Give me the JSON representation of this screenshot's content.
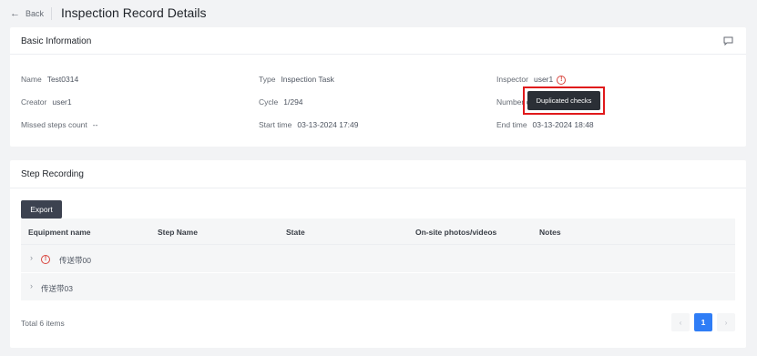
{
  "header": {
    "back_label": "Back",
    "title": "Inspection Record Details"
  },
  "basic_info": {
    "title": "Basic Information",
    "fields": {
      "name": {
        "label": "Name",
        "value": "Test0314"
      },
      "type": {
        "label": "Type",
        "value": "Inspection Task"
      },
      "inspector": {
        "label": "Inspector",
        "value": "user1"
      },
      "creator": {
        "label": "Creator",
        "value": "user1"
      },
      "cycle": {
        "label": "Cycle",
        "value": "1/294"
      },
      "number": {
        "label": "Number c"
      },
      "missed": {
        "label": "Missed steps count",
        "value": "--"
      },
      "start_time": {
        "label": "Start time",
        "value": "03-13-2024 17:49"
      },
      "end_time": {
        "label": "End time",
        "value": "03-13-2024 18:48"
      }
    },
    "tooltip": "Duplicated checks"
  },
  "step_recording": {
    "title": "Step Recording",
    "export_label": "Export",
    "columns": [
      "Equipment name",
      "Step Name",
      "State",
      "On-site photos/videos",
      "Notes"
    ],
    "rows": [
      {
        "name": "传送带00",
        "warning": true
      },
      {
        "name": "传送带03",
        "warning": false
      }
    ],
    "total": "Total 6 items",
    "pagination": {
      "prev": "‹",
      "current": "1",
      "next": "›"
    }
  },
  "icons": {
    "back": "left-arrow-icon",
    "comment": "comment-icon",
    "warning": "warning-circle-icon",
    "expand": "chevron-right-icon"
  },
  "colors": {
    "warning": "#d9453e",
    "primary": "#2f7df6",
    "highlight_border": "#e0191b",
    "export_bg": "#3c4250"
  }
}
